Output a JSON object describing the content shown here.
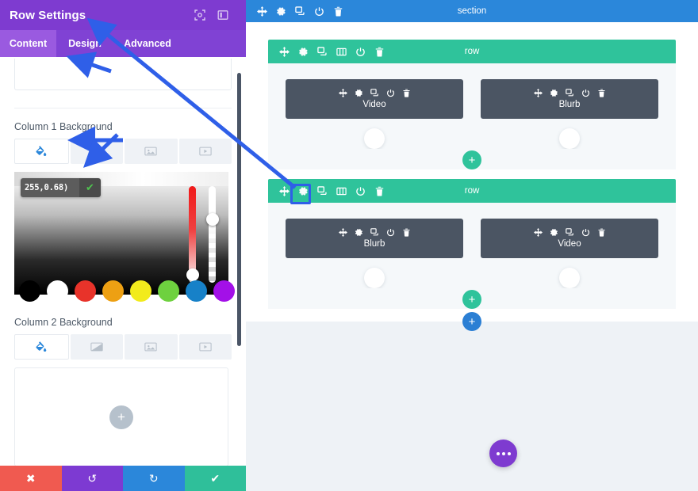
{
  "panel": {
    "title": "Row Settings",
    "header_icons": [
      {
        "name": "fullscreen-icon",
        "glyph": "expand"
      },
      {
        "name": "layout-panel-icon",
        "glyph": "panel"
      }
    ],
    "tabs": [
      {
        "label": "Content",
        "active": true
      },
      {
        "label": "Design",
        "active": false
      },
      {
        "label": "Advanced",
        "active": false
      }
    ],
    "column1": {
      "label": "Column 1 Background",
      "bg_tabs": [
        {
          "name": "background-color-tab",
          "icon": "paint-bucket-icon",
          "active": true
        },
        {
          "name": "background-gradient-tab",
          "icon": "gradient-icon",
          "active": false
        },
        {
          "name": "background-image-tab",
          "icon": "image-icon",
          "active": false
        },
        {
          "name": "background-video-tab",
          "icon": "video-icon",
          "active": false
        }
      ],
      "color_value": "255,0.68)",
      "color_confirm_glyph": "✔",
      "swatches": [
        {
          "name": "swatch-black",
          "color": "#000000"
        },
        {
          "name": "swatch-white",
          "color": "#ffffff"
        },
        {
          "name": "swatch-red",
          "color": "#e8332a"
        },
        {
          "name": "swatch-orange",
          "color": "#eda013"
        },
        {
          "name": "swatch-yellow",
          "color": "#f2eb1c"
        },
        {
          "name": "swatch-green",
          "color": "#6ed13f"
        },
        {
          "name": "swatch-blue",
          "color": "#1781c8"
        },
        {
          "name": "swatch-purple",
          "color": "#a310e8"
        }
      ]
    },
    "column2": {
      "label": "Column 2 Background",
      "bg_tabs": [
        {
          "name": "background-color-tab",
          "icon": "paint-bucket-icon",
          "active": true
        },
        {
          "name": "background-gradient-tab",
          "icon": "gradient-icon",
          "active": false
        },
        {
          "name": "background-image-tab",
          "icon": "image-icon",
          "active": false
        },
        {
          "name": "background-video-tab",
          "icon": "video-icon",
          "active": false
        }
      ],
      "add_glyph": "+"
    },
    "footer": [
      {
        "name": "cancel-button",
        "glyph": "✖",
        "color": "#f05a50"
      },
      {
        "name": "undo-button",
        "glyph": "↺",
        "color": "#7d3ad2"
      },
      {
        "name": "redo-button",
        "glyph": "↻",
        "color": "#2b87da"
      },
      {
        "name": "save-button",
        "glyph": "✔",
        "color": "#2fbf9a"
      }
    ]
  },
  "canvas": {
    "section": {
      "label": "section",
      "color": "#2b87da",
      "icons": [
        "move-icon",
        "gear-icon",
        "duplicate-icon",
        "power-icon",
        "trash-icon"
      ]
    },
    "rows": [
      {
        "label": "row",
        "color": "#2fc39b",
        "icons": [
          "move-icon",
          "gear-icon",
          "duplicate-icon",
          "columns-icon",
          "power-icon",
          "trash-icon"
        ],
        "modules": [
          {
            "label": "Video",
            "icons": [
              "move-icon",
              "gear-icon",
              "duplicate-icon",
              "power-icon",
              "trash-icon"
            ]
          },
          {
            "label": "Blurb",
            "icons": [
              "move-icon",
              "gear-icon",
              "duplicate-icon",
              "power-icon",
              "trash-icon"
            ]
          }
        ]
      },
      {
        "label": "row",
        "color": "#2fc39b",
        "icons": [
          "move-icon",
          "gear-icon",
          "duplicate-icon",
          "columns-icon",
          "power-icon",
          "trash-icon"
        ],
        "modules": [
          {
            "label": "Blurb",
            "icons": [
              "move-icon",
              "gear-icon",
              "duplicate-icon",
              "power-icon",
              "trash-icon"
            ]
          },
          {
            "label": "Video",
            "icons": [
              "move-icon",
              "gear-icon",
              "duplicate-icon",
              "power-icon",
              "trash-icon"
            ]
          }
        ]
      }
    ],
    "add_row_glyph": "+",
    "add_section_glyph": "+",
    "fab": {
      "name": "builder-menu-fab",
      "glyph": "..."
    }
  },
  "annotations": {
    "highlight_color": "#2f5fe8"
  }
}
